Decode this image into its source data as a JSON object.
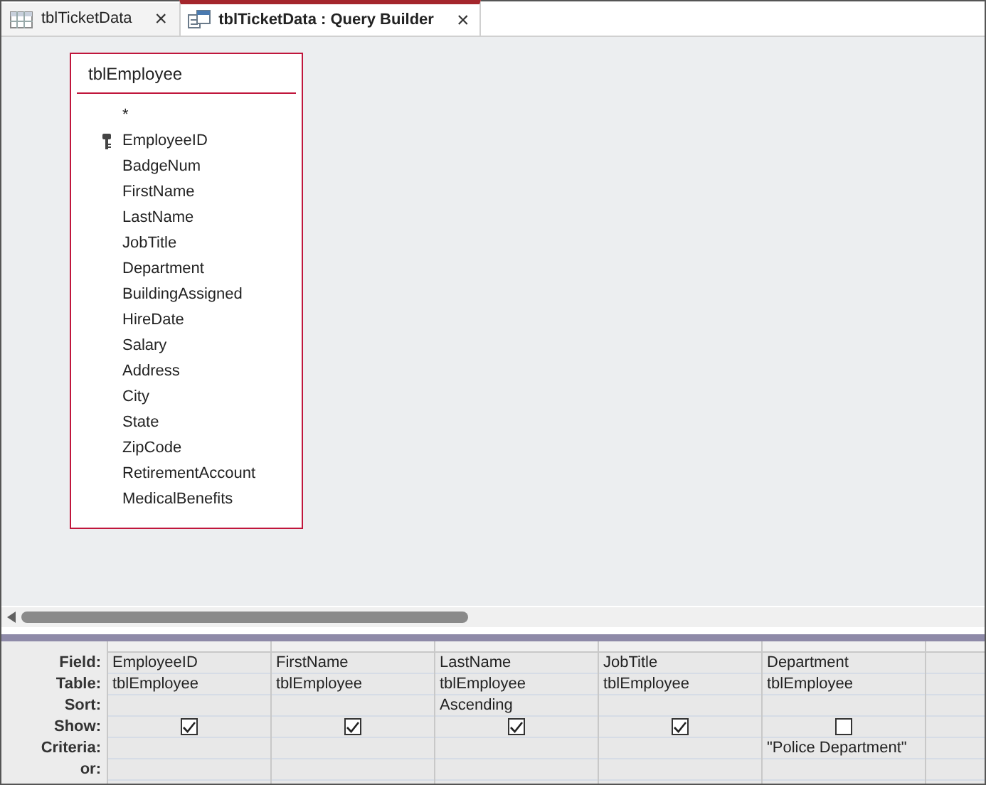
{
  "tabs": [
    {
      "label": "tblTicketData",
      "kind": "table",
      "selected": false,
      "close": "×"
    },
    {
      "label": "tblTicketData : Query Builder",
      "kind": "query",
      "selected": true,
      "close": "×"
    }
  ],
  "field_list": {
    "title": "tblEmployee",
    "fields": [
      {
        "name": "*",
        "primary_key": false
      },
      {
        "name": "EmployeeID",
        "primary_key": true
      },
      {
        "name": "BadgeNum",
        "primary_key": false
      },
      {
        "name": "FirstName",
        "primary_key": false
      },
      {
        "name": "LastName",
        "primary_key": false
      },
      {
        "name": "JobTitle",
        "primary_key": false
      },
      {
        "name": "Department",
        "primary_key": false
      },
      {
        "name": "BuildingAssigned",
        "primary_key": false
      },
      {
        "name": "HireDate",
        "primary_key": false
      },
      {
        "name": "Salary",
        "primary_key": false
      },
      {
        "name": "Address",
        "primary_key": false
      },
      {
        "name": "City",
        "primary_key": false
      },
      {
        "name": "State",
        "primary_key": false
      },
      {
        "name": "ZipCode",
        "primary_key": false
      },
      {
        "name": "RetirementAccount",
        "primary_key": false
      },
      {
        "name": "MedicalBenefits",
        "primary_key": false
      }
    ]
  },
  "grid": {
    "row_labels": [
      "Field:",
      "Table:",
      "Sort:",
      "Show:",
      "Criteria:",
      "or:"
    ],
    "columns": [
      {
        "field": "EmployeeID",
        "table": "tblEmployee",
        "show": true
      },
      {
        "field": "FirstName",
        "table": "tblEmployee",
        "show": true
      },
      {
        "field": "LastName",
        "table": "tblEmployee",
        "sort": "Ascending",
        "show": true
      },
      {
        "field": "JobTitle",
        "table": "tblEmployee",
        "show": true
      },
      {
        "field": "Department",
        "table": "tblEmployee",
        "show": false,
        "criteria": "\"Police Department\""
      }
    ]
  }
}
